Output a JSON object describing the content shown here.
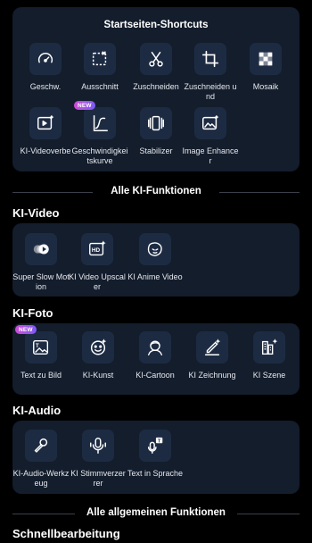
{
  "shortcuts": {
    "title": "Startseiten-Shortcuts",
    "items": [
      {
        "label": "Geschw.",
        "icon": "speedometer-icon"
      },
      {
        "label": "Ausschnitt",
        "icon": "crop-selection-icon"
      },
      {
        "label": "Zuschneiden",
        "icon": "scissors-icon"
      },
      {
        "label": "Zuschneiden und",
        "icon": "crop-icon"
      },
      {
        "label": "Mosaik",
        "icon": "mosaic-icon"
      },
      {
        "label": "KI-Videoverbe",
        "icon": "ai-video-enhance-icon"
      },
      {
        "label": "Geschwindigkeitskurve",
        "icon": "speed-curve-icon",
        "badge": "NEW"
      },
      {
        "label": "Stabilizer",
        "icon": "stabilizer-icon"
      },
      {
        "label": "Image Enhancer",
        "icon": "image-enhancer-icon"
      }
    ]
  },
  "ai_all": {
    "label": "Alle KI-Funktionen"
  },
  "ai_video": {
    "title": "KI-Video",
    "items": [
      {
        "label": "Super Slow Motion",
        "icon": "slow-motion-icon"
      },
      {
        "label": "KI Video Upscaler",
        "icon": "hd-upscaler-icon"
      },
      {
        "label": "KI Anime Video",
        "icon": "anime-icon"
      }
    ]
  },
  "ai_photo": {
    "title": "KI-Foto",
    "items": [
      {
        "label": "Text zu Bild",
        "icon": "text-to-image-icon",
        "badge": "NEW"
      },
      {
        "label": "KI-Kunst",
        "icon": "ai-art-face-icon"
      },
      {
        "label": "KI-Cartoon",
        "icon": "cartoon-icon"
      },
      {
        "label": "KI Zeichnung",
        "icon": "drawing-icon"
      },
      {
        "label": "KI Szene",
        "icon": "scene-icon"
      }
    ]
  },
  "ai_audio": {
    "title": "KI-Audio",
    "items": [
      {
        "label": "KI-Audio-Werkzeug",
        "icon": "audio-tool-icon"
      },
      {
        "label": "KI Stimmverzerrer",
        "icon": "voice-changer-icon"
      },
      {
        "label": "Text in Sprache",
        "icon": "text-to-speech-icon"
      }
    ]
  },
  "general_all": {
    "label": "Alle allgemeinen Funktionen"
  },
  "quick_edit": {
    "title": "Schnellbearbeitung"
  }
}
